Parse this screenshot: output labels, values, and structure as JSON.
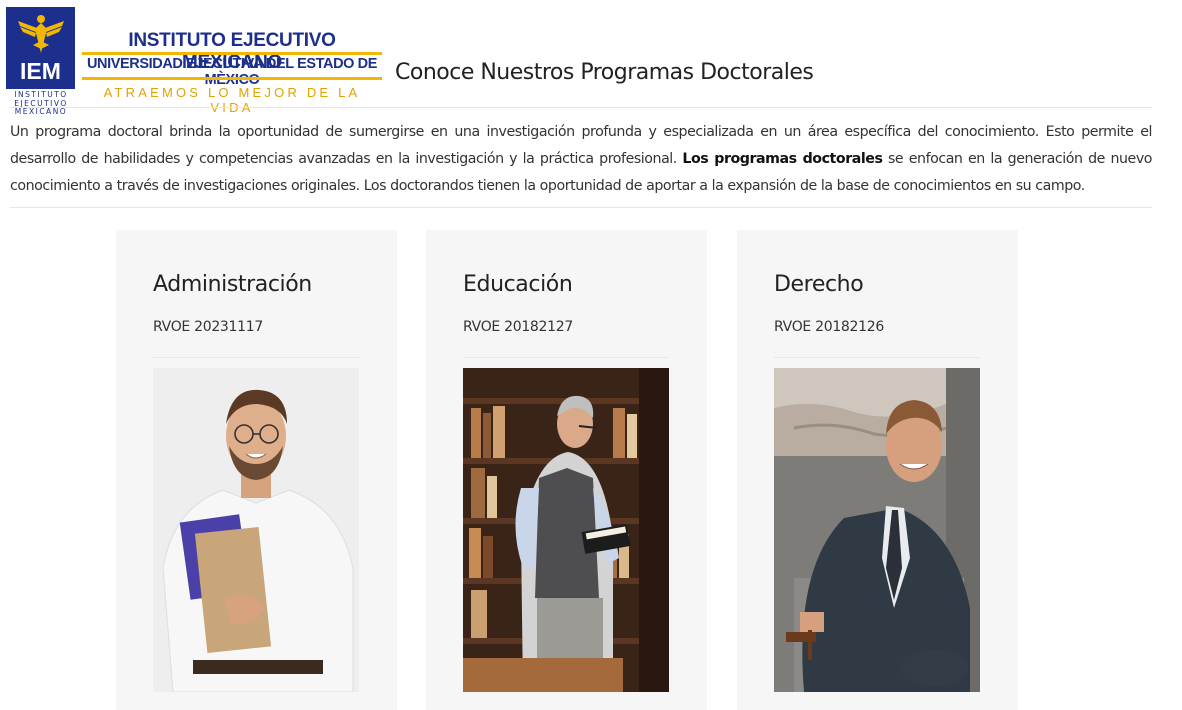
{
  "logo": {
    "badge_text": "IEM",
    "subtitle_lines": [
      "INSTITUTO",
      "EJECUTIVO",
      "MEXICANO"
    ],
    "institute_name": "INSTITUTO EJECUTIVO MEXICANO",
    "university_name": "UNIVERSIDAD EJECUTIVA DEL ESTADO DE MÈXICO",
    "slogan": "ATRAEMOS LO MEJOR DE LA VIDA",
    "icon": "eagle-emblem-icon",
    "colors": {
      "primary": "#1c2f8c",
      "accent": "#f2b705"
    }
  },
  "page": {
    "title": "Conoce Nuestros Programas Doctorales"
  },
  "intro": {
    "text_before": "Un programa doctoral brinda la oportunidad de sumergirse en una investigación profunda y especializada en un área específica del conocimiento. Esto permite el desarrollo de habilidades y competencias avanzadas en la investigación y la práctica profesional. ",
    "bold": "Los programas doctorales",
    "text_after": " se enfocan en la generación de nuevo conocimiento a través de investigaciones originales. Los doctorandos tienen la oportunidad de aportar a la expansión de la base de conocimientos en su campo."
  },
  "programs": [
    {
      "title": "Administración",
      "rvoe": "RVOE 20231117",
      "photo": "smiling-man-holding-notebooks-photo"
    },
    {
      "title": "Educación",
      "rvoe": "RVOE 20182127",
      "photo": "older-man-reading-in-library-photo"
    },
    {
      "title": "Derecho",
      "rvoe": "RVOE 20182126",
      "photo": "man-in-suit-with-gavel-photo"
    }
  ]
}
